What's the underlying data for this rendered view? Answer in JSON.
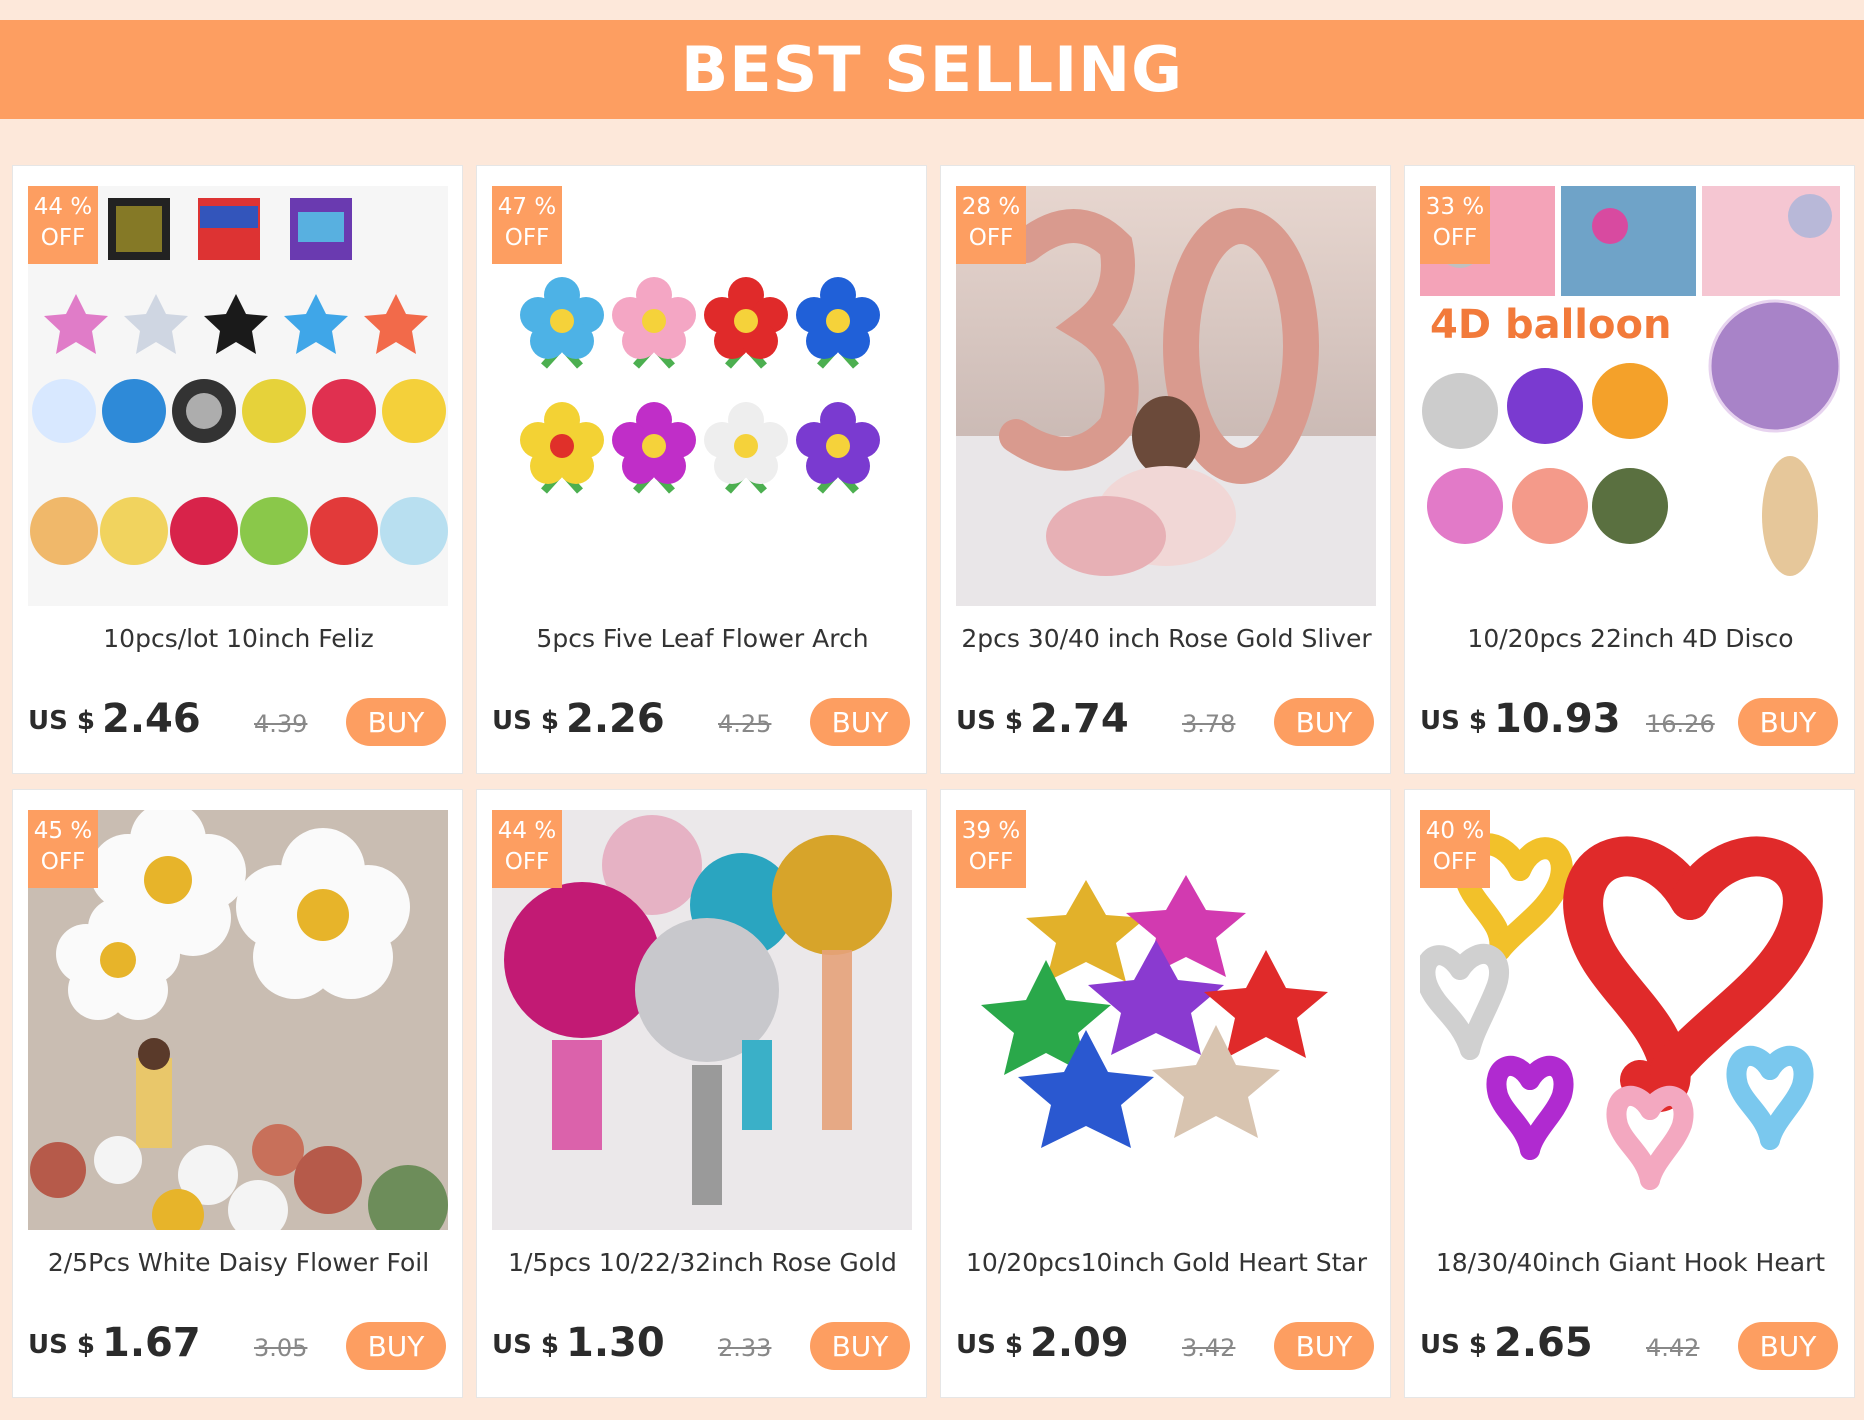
{
  "banner": {
    "title": "BEST SELLING"
  },
  "colors": {
    "accent": "#fd9e61",
    "background": "#fde8da",
    "card": "#ffffff"
  },
  "products": [
    {
      "discount": "44 %",
      "off": "OFF",
      "title": "10pcs/lot 10inch Feliz",
      "currency": "US $",
      "price": "2.46",
      "old_price": "4.39",
      "buy": "BUY",
      "image": "mini-foil-balloons"
    },
    {
      "discount": "47 %",
      "off": "OFF",
      "title": "5pcs Five Leaf Flower Arch",
      "currency": "US $",
      "price": "2.26",
      "old_price": "4.25",
      "buy": "BUY",
      "image": "flower-balloons"
    },
    {
      "discount": "28 %",
      "off": "OFF",
      "title": "2pcs 30/40 inch Rose Gold Sliver",
      "currency": "US $",
      "price": "2.74",
      "old_price": "3.78",
      "buy": "BUY",
      "image": "number-30-balloons"
    },
    {
      "discount": "33 %",
      "off": "OFF",
      "title": "10/20pcs 22inch 4D Disco",
      "currency": "US $",
      "price": "10.93",
      "old_price": "16.26",
      "buy": "BUY",
      "image": "4d-balloons",
      "image_text": "4D balloon"
    },
    {
      "discount": "45 %",
      "off": "OFF",
      "title": "2/5Pcs White Daisy Flower Foil",
      "currency": "US $",
      "price": "1.67",
      "old_price": "3.05",
      "buy": "BUY",
      "image": "daisy-balloons"
    },
    {
      "discount": "44 %",
      "off": "OFF",
      "title": "1/5pcs 10/22/32inch Rose Gold",
      "currency": "US $",
      "price": "1.30",
      "old_price": "2.33",
      "buy": "BUY",
      "image": "sphere-balloons"
    },
    {
      "discount": "39 %",
      "off": "OFF",
      "title": "10/20pcs10inch Gold Heart Star",
      "currency": "US $",
      "price": "2.09",
      "old_price": "3.42",
      "buy": "BUY",
      "image": "star-balloons"
    },
    {
      "discount": "40 %",
      "off": "OFF",
      "title": "18/30/40inch Giant Hook Heart",
      "currency": "US $",
      "price": "2.65",
      "old_price": "4.42",
      "buy": "BUY",
      "image": "heart-balloons"
    }
  ]
}
